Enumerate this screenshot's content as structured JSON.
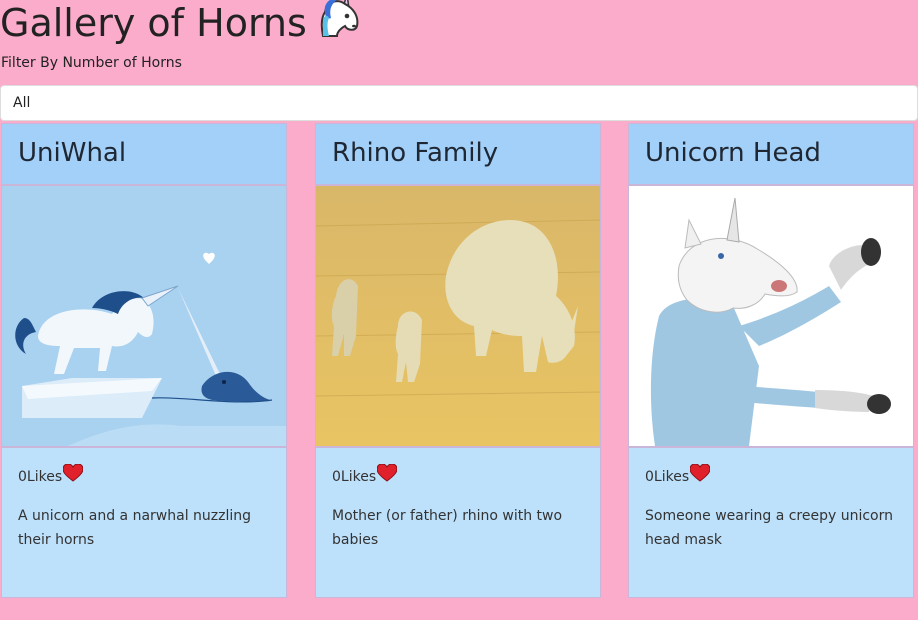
{
  "header": {
    "title": "Gallery of Horns",
    "title_icon": "unicorn-face-icon"
  },
  "filter": {
    "label": "Filter By Number of Horns",
    "selected": "All"
  },
  "cards": [
    {
      "title": "UniWhal",
      "likes": "0",
      "likes_label": "Likes",
      "description": "A unicorn and a narwhal nuzzling their horns",
      "image": "unicorn-narwhal-illustration"
    },
    {
      "title": "Rhino Family",
      "likes": "0",
      "likes_label": "Likes",
      "description": "Mother (or father) rhino with two babies",
      "image": "rhino-family-photo"
    },
    {
      "title": "Unicorn Head",
      "likes": "0",
      "likes_label": "Likes",
      "description": "Someone wearing a creepy unicorn head mask",
      "image": "unicorn-mask-photo"
    }
  ],
  "colors": {
    "background": "#fcaccb",
    "card_body": "#bde0fb",
    "card_header": "#a2d0f9",
    "heart": "#e0202a"
  }
}
